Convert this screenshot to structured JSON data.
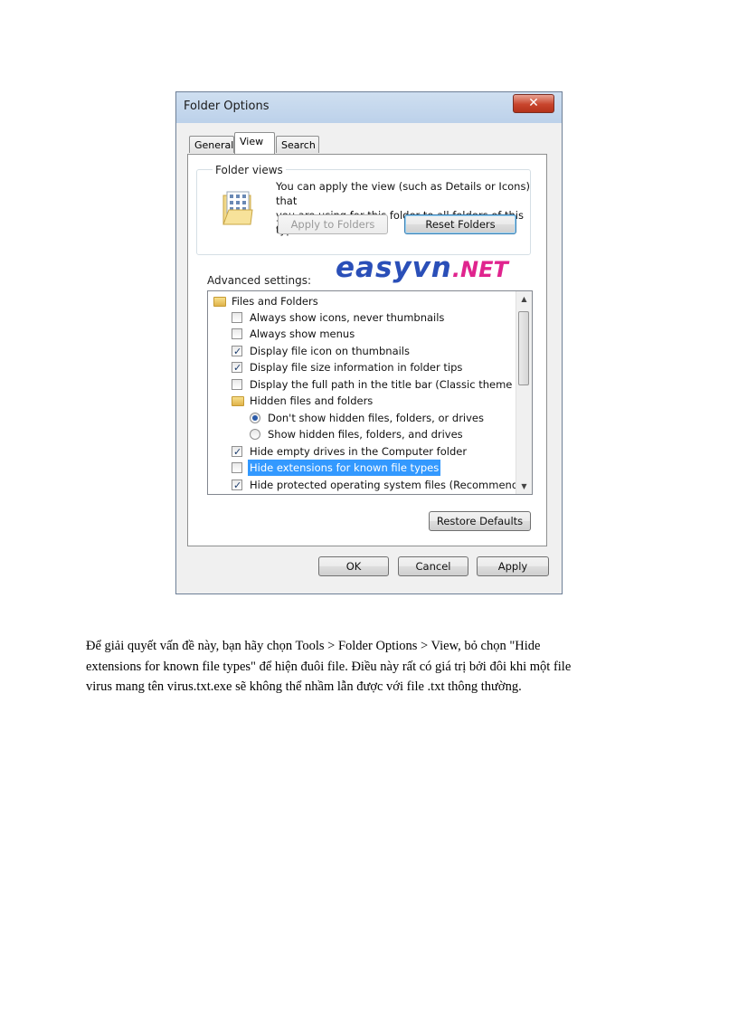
{
  "dialog": {
    "title": "Folder Options",
    "close_glyph": "✕",
    "tabs": [
      {
        "label": "General",
        "active": false
      },
      {
        "label": "View",
        "active": true
      },
      {
        "label": "Search",
        "active": false
      }
    ],
    "folder_views": {
      "legend": "Folder views",
      "description_line1": "You can apply the view (such as Details or Icons) that",
      "description_line2": "you are using for this folder to all folders of this type.",
      "apply_button": "Apply to Folders",
      "reset_button": "Reset Folders"
    },
    "advanced_label": "Advanced settings:",
    "watermark": {
      "main": "easyvn",
      "tld": ".NET"
    },
    "settings": [
      {
        "type": "folder",
        "label": "Files and Folders"
      },
      {
        "type": "checkbox",
        "checked": false,
        "label": "Always show icons, never thumbnails"
      },
      {
        "type": "checkbox",
        "checked": false,
        "label": "Always show menus"
      },
      {
        "type": "checkbox",
        "checked": true,
        "label": "Display file icon on thumbnails"
      },
      {
        "type": "checkbox",
        "checked": true,
        "label": "Display file size information in folder tips"
      },
      {
        "type": "checkbox",
        "checked": false,
        "label": "Display the full path in the title bar (Classic theme only)"
      },
      {
        "type": "folder",
        "label": "Hidden files and folders"
      },
      {
        "type": "radio",
        "checked": true,
        "label": "Don't show hidden files, folders, or drives"
      },
      {
        "type": "radio",
        "checked": false,
        "label": "Show hidden files, folders, and drives"
      },
      {
        "type": "checkbox",
        "checked": true,
        "label": "Hide empty drives in the Computer folder"
      },
      {
        "type": "checkbox",
        "checked": false,
        "selected": true,
        "label": "Hide extensions for known file types"
      },
      {
        "type": "checkbox",
        "checked": true,
        "label": "Hide protected operating system files (Recommended)"
      }
    ],
    "restore_button": "Restore Defaults",
    "ok_button": "OK",
    "cancel_button": "Cancel",
    "apply_button": "Apply",
    "colors": {
      "selection": "#3399ff",
      "watermark_blue": "#2a4fb8",
      "watermark_pink": "#e0248e"
    }
  },
  "caption": {
    "line1": "Để giải  quyết vấn đề này, bạn hãy chọn Tools > Folder Options  > View, bỏ chọn \"Hide",
    "line2": "extensions  for known file  types\"  để hiện  đuôi file.  Điều này rất có giá trị bởi đôi khi một file",
    "line3": "virus  mang  tên virus.txt.exe   sẽ không  thể nhầm  lẫn được với file  .txt thông  thường."
  }
}
